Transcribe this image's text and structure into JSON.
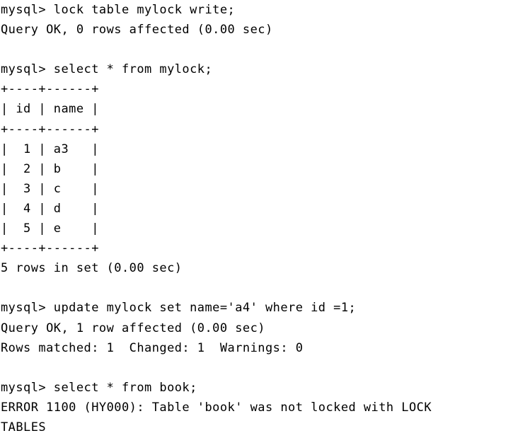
{
  "terminal": {
    "lines": [
      "mysql> lock table mylock write;",
      "Query OK, 0 rows affected (0.00 sec)",
      "",
      "mysql> select * from mylock;",
      "+----+------+",
      "| id | name |",
      "+----+------+",
      "|  1 | a3   |",
      "|  2 | b    |",
      "|  3 | c    |",
      "|  4 | d    |",
      "|  5 | e    |",
      "+----+------+",
      "5 rows in set (0.00 sec)",
      "",
      "mysql> update mylock set name='a4' where id =1;",
      "Query OK, 1 row affected (0.00 sec)",
      "Rows matched: 1  Changed: 1  Warnings: 0",
      "",
      "mysql> select * from book;",
      "ERROR 1100 (HY000): Table 'book' was not locked with LOCK",
      "TABLES"
    ]
  }
}
